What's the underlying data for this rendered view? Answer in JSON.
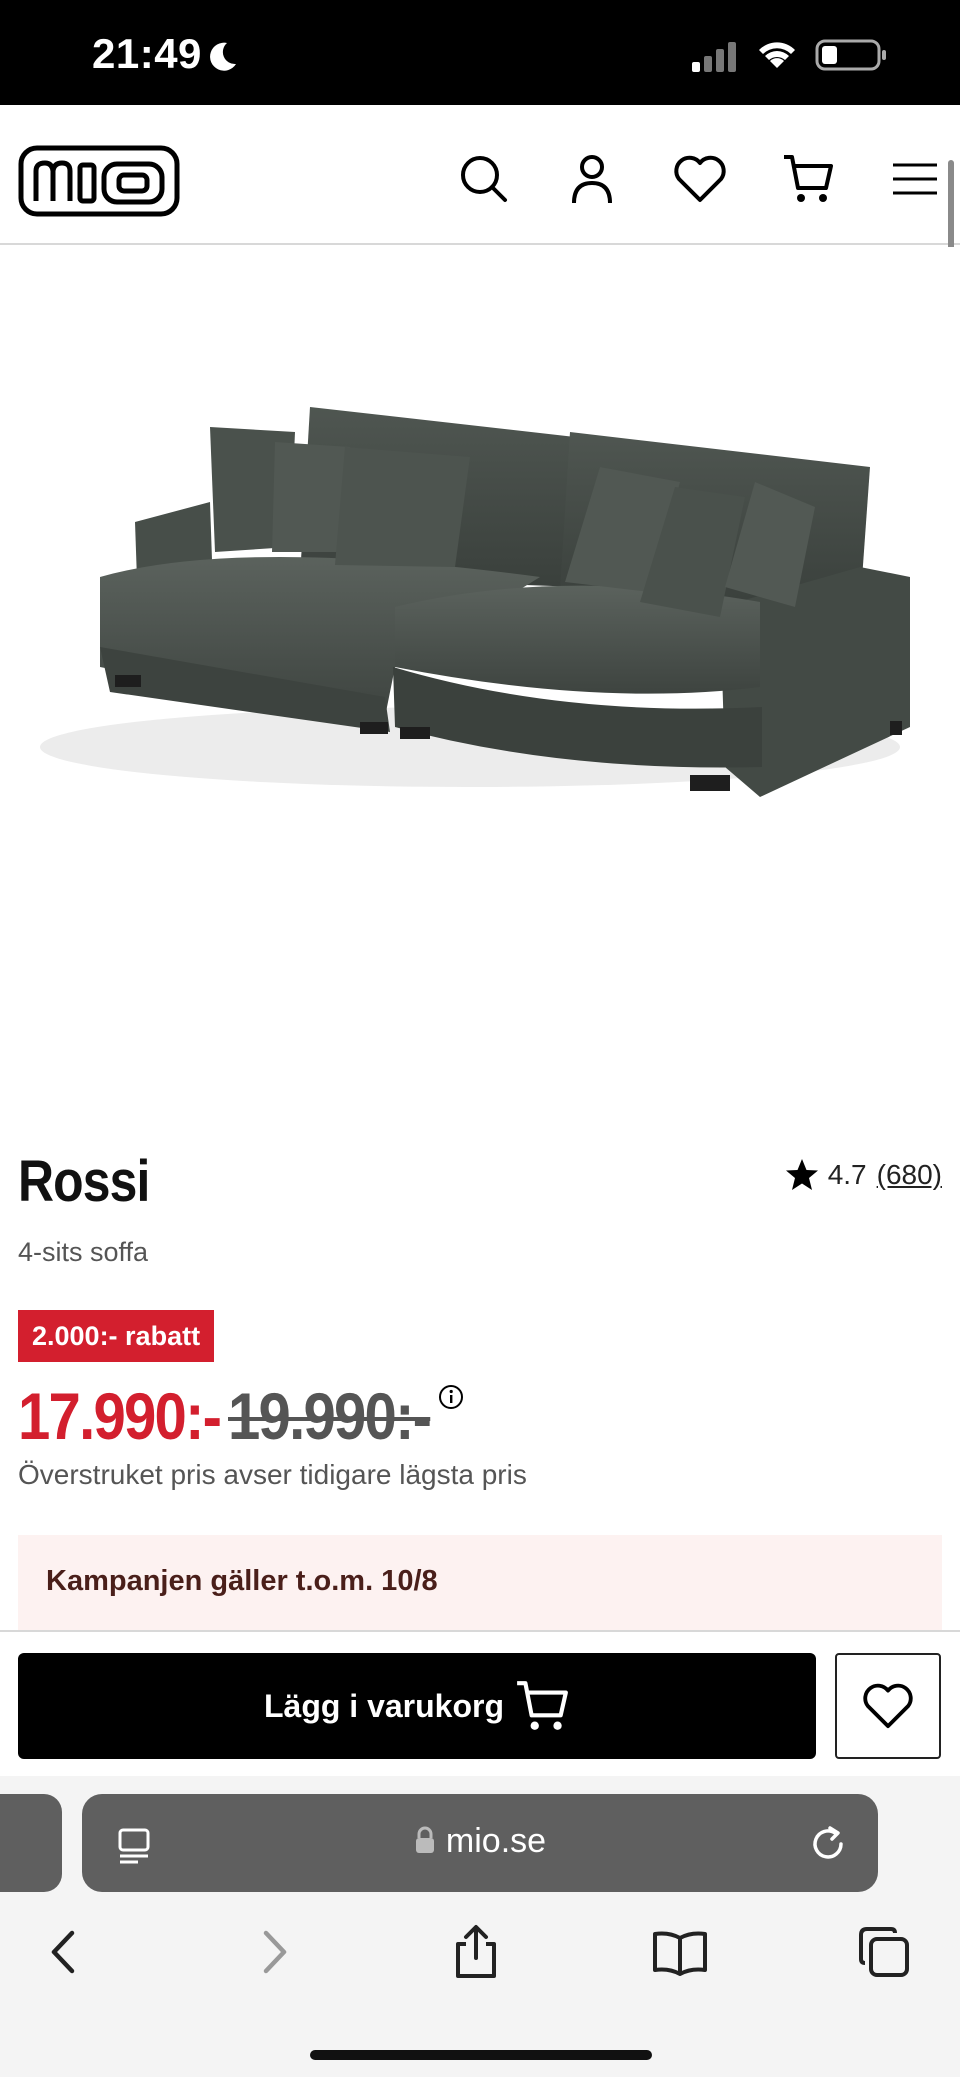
{
  "status_bar": {
    "time": "21:49"
  },
  "header": {
    "logo_text": "mio",
    "icons": [
      "search-icon",
      "account-icon",
      "heart-icon",
      "cart-icon",
      "menu-icon"
    ]
  },
  "product": {
    "name": "Rossi",
    "subtitle": "4-sits soffa",
    "rating": "4.7",
    "review_count": "(680)",
    "discount": "2.000:- rabatt",
    "price": "17.990:-",
    "old_price": "19.990:-",
    "price_note": "Överstruket pris avser tidigare lägsta pris",
    "campaign": "Kampanjen gäller t.o.m. 10/8",
    "sofa_color": "#4a514c"
  },
  "buy_bar": {
    "add_to_cart": "Lägg i varukorg"
  },
  "browser": {
    "url": "mio.se"
  },
  "colors": {
    "sale_red": "#d31f2e",
    "campaign_bg": "#fdf2f1"
  }
}
